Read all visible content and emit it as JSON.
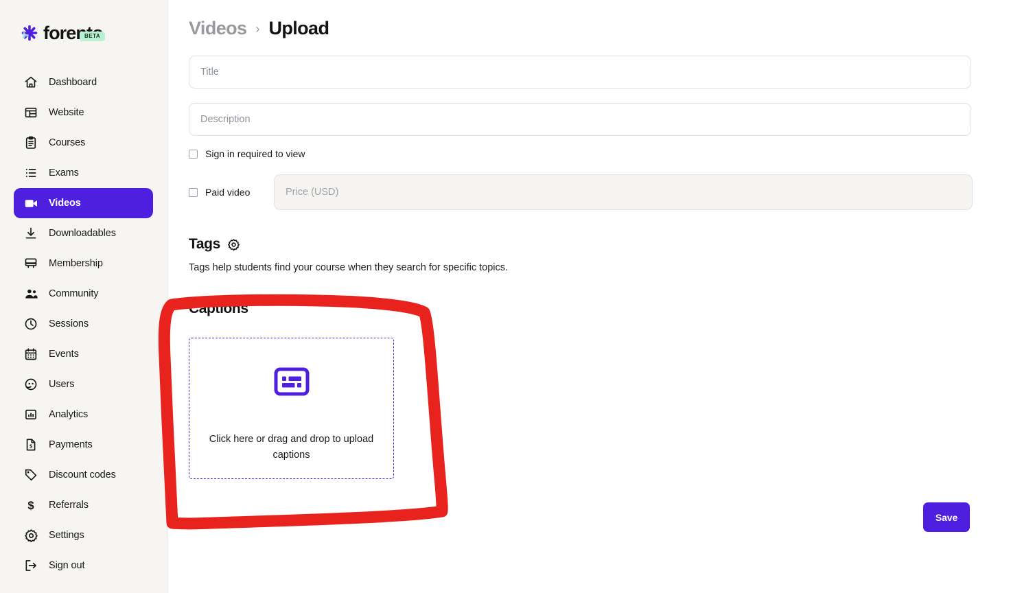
{
  "brand": {
    "name": "forento",
    "badge": "BETA",
    "logo_icon": "asterisk-icon",
    "accent_color": "#4f1fe0",
    "badge_color": "#b9efd3",
    "sidebar_color": "#f7f5f1",
    "annotation_color": "#e8231e"
  },
  "sidebar": {
    "items": [
      {
        "label": "Dashboard",
        "icon": "home-icon",
        "active": false
      },
      {
        "label": "Website",
        "icon": "browser-icon",
        "active": false
      },
      {
        "label": "Courses",
        "icon": "clipboard-icon",
        "active": false
      },
      {
        "label": "Exams",
        "icon": "list-icon",
        "active": false
      },
      {
        "label": "Videos",
        "icon": "video-camera-icon",
        "active": true
      },
      {
        "label": "Downloadables",
        "icon": "download-icon",
        "active": false
      },
      {
        "label": "Membership",
        "icon": "monitor-icon",
        "active": false
      },
      {
        "label": "Community",
        "icon": "people-icon",
        "active": false
      },
      {
        "label": "Sessions",
        "icon": "clock-icon",
        "active": false
      },
      {
        "label": "Events",
        "icon": "calendar-icon",
        "active": false
      },
      {
        "label": "Users",
        "icon": "user-face-icon",
        "active": false
      },
      {
        "label": "Analytics",
        "icon": "bar-chart-icon",
        "active": false
      },
      {
        "label": "Payments",
        "icon": "invoice-icon",
        "active": false
      },
      {
        "label": "Discount codes",
        "icon": "tag-icon",
        "active": false
      },
      {
        "label": "Referrals",
        "icon": "dollar-icon",
        "active": false
      },
      {
        "label": "Settings",
        "icon": "gear-icon",
        "active": false
      },
      {
        "label": "Sign out",
        "icon": "sign-out-icon",
        "active": false
      }
    ]
  },
  "breadcrumb": {
    "parent": "Videos",
    "separator": "›",
    "current": "Upload"
  },
  "form": {
    "title_field": {
      "value": "",
      "placeholder": "Title"
    },
    "description_field": {
      "value": "",
      "placeholder": "Description"
    },
    "sign_in_required": {
      "label": "Sign in required to view",
      "checked": false
    },
    "paid_video": {
      "label": "Paid video",
      "checked": false
    },
    "price_field": {
      "value": "",
      "placeholder": "Price (USD)",
      "disabled": true
    }
  },
  "tags": {
    "heading": "Tags",
    "settings_icon": "gear-icon",
    "description": "Tags help students find your course when they search for specific topics."
  },
  "captions": {
    "heading": "Captions",
    "dropzone_icon": "closed-caption-icon",
    "dropzone_text": "Click here or drag and drop to upload captions"
  },
  "actions": {
    "save_label": "Save"
  }
}
